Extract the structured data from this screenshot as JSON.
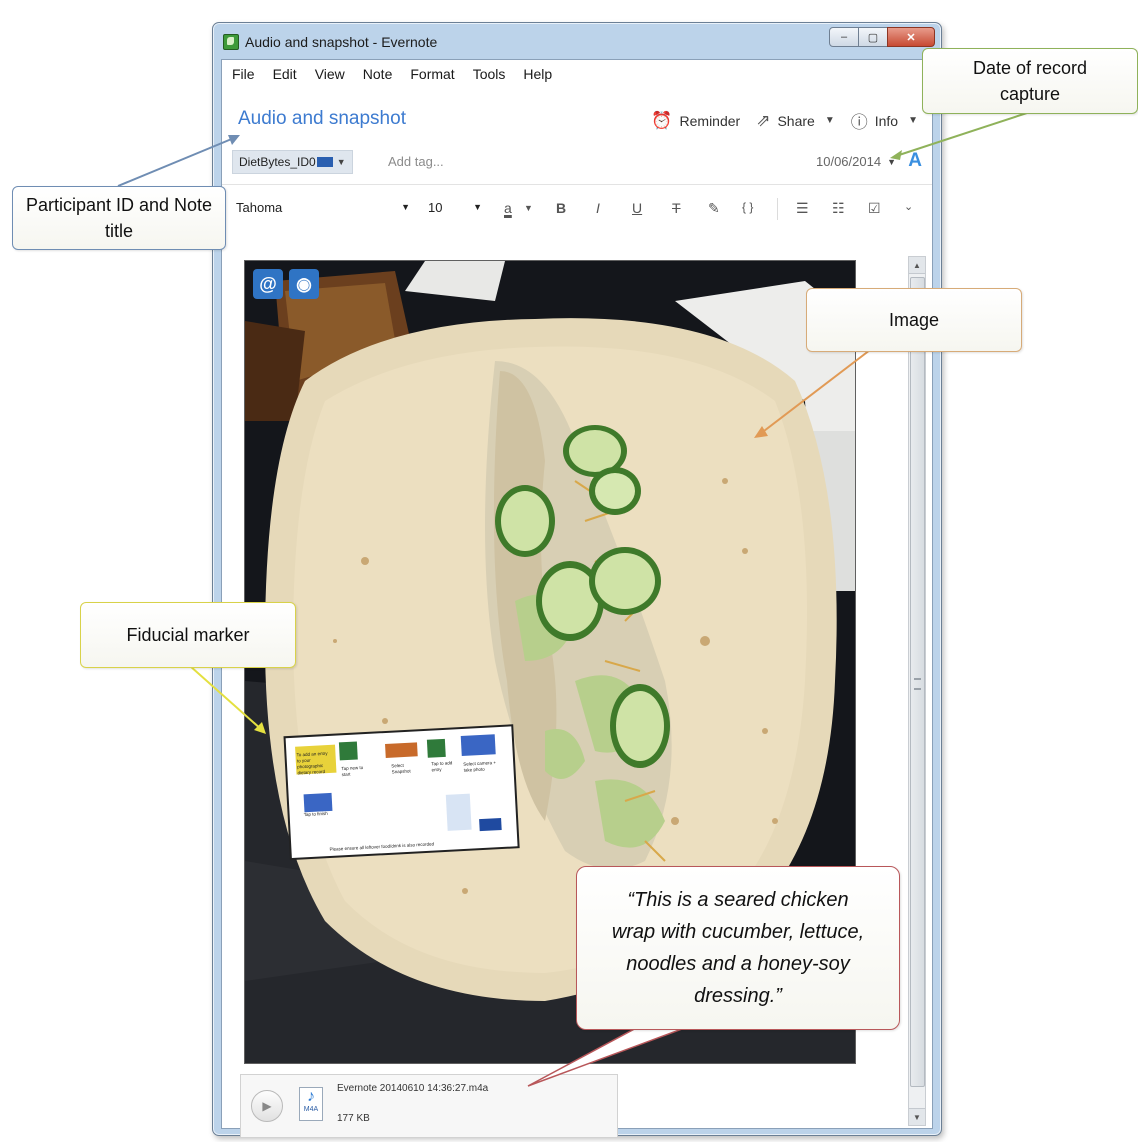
{
  "window": {
    "title": "Audio and snapshot - Evernote",
    "controls": {
      "minimize": "–",
      "maximize": "▢",
      "close": "✕"
    }
  },
  "menubar": [
    "File",
    "Edit",
    "View",
    "Note",
    "Format",
    "Tools",
    "Help"
  ],
  "note": {
    "title": "Audio and snapshot",
    "actions": {
      "reminder": "Reminder",
      "share": "Share",
      "info": "Info"
    },
    "tag": "DietBytes_ID0",
    "add_tag_placeholder": "Add tag...",
    "date": "10/06/2014"
  },
  "formatting": {
    "font": "Tahoma",
    "size": "10",
    "buttons": {
      "bold": "B",
      "italic": "I",
      "underline": "U",
      "strike": "T",
      "highlight": "✎",
      "code": "{ }"
    }
  },
  "photo": {
    "marker_lines": [
      "To add an entry to your photographic dietary record",
      "Tap new to start",
      "Select Snapshot",
      "Tap to add entry",
      "Select camera + take photo",
      "Tap to finish",
      "Please ensure all leftover food/drink is also recorded"
    ]
  },
  "attachment": {
    "filename": "Evernote 20140610 14:36:27.m4a",
    "size": "177 KB",
    "icon_label": "M4A"
  },
  "callouts": {
    "date": "Date of record capture",
    "participant": "Participant ID and Note title",
    "image": "Image",
    "fiducial": "Fiducial marker",
    "quote": "“This is a seared chicken wrap with cucumber, lettuce, noodles and a honey-soy dressing.”"
  },
  "colors": {
    "title_blue": "#3d7bd0",
    "callout_date": "#8fb25a",
    "callout_participant": "#6f8db3",
    "callout_image": "#d7ab78",
    "callout_fiducial": "#d8d24a",
    "callout_quote": "#b8575a"
  }
}
